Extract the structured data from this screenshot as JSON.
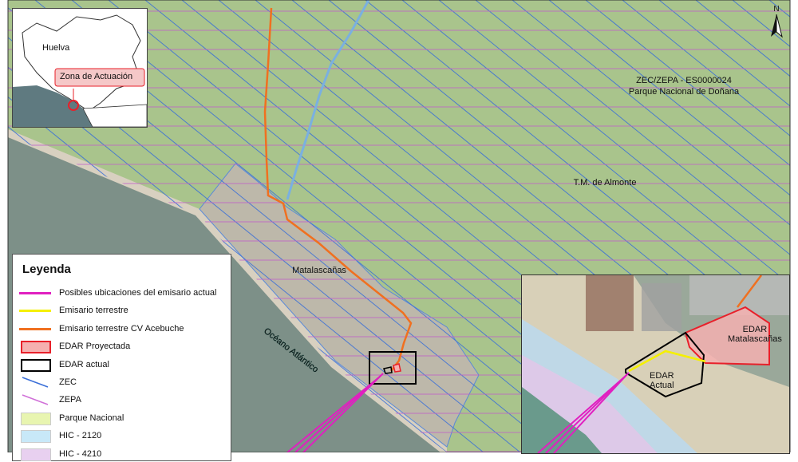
{
  "map_labels": {
    "zec_zepa_line1": "ZEC/ZEPA - ES0000024",
    "zec_zepa_line2": "Parque Nacional de Doñana",
    "tm_almonte": "T.M. de Almonte",
    "matalascanas": "Matalascañas",
    "oceano": "Océano Atlántico",
    "north": "N"
  },
  "locator": {
    "province": "Huelva",
    "callout": "Zona de Actuación"
  },
  "inset": {
    "edar_matalascanas_line1": "EDAR",
    "edar_matalascanas_line2": "Matalascañas",
    "edar_actual_line1": "EDAR",
    "edar_actual_line2": "Actual"
  },
  "legend": {
    "title": "Leyenda",
    "items": [
      {
        "label": "Posibles ubicaciones del emisario actual",
        "symbol": "line",
        "color": "#e020c0"
      },
      {
        "label": "Emisario terrestre",
        "symbol": "line",
        "color": "#f5f000"
      },
      {
        "label": "Emisario terrestre CV Acebuche",
        "symbol": "line",
        "color": "#f07020"
      },
      {
        "label": "EDAR Proyectada",
        "symbol": "box",
        "color": "#e8202a",
        "fill": "#f5b0b0"
      },
      {
        "label": "EDAR actual",
        "symbol": "box",
        "color": "#000000",
        "fill": "#ffffff"
      },
      {
        "label": "ZEC",
        "symbol": "hatch",
        "color": "#3a6fd8"
      },
      {
        "label": "ZEPA",
        "symbol": "hatch",
        "color": "#d070d8"
      },
      {
        "label": "Parque Nacional",
        "symbol": "fill",
        "color": "#e8f5b0"
      },
      {
        "label": "HIC - 2120",
        "symbol": "fill",
        "color": "#c8e8f8"
      },
      {
        "label": "HIC - 4210",
        "symbol": "fill",
        "color": "#e8d0f0"
      }
    ]
  },
  "colors": {
    "land": "#a8c08a",
    "sea": "#7d9088",
    "town": "#b8b4a8",
    "zec_hatch": "#3a6fd8",
    "zepa_hatch": "#c060c8",
    "emisario_cv": "#f07020",
    "emisario_actual": "#e020c0"
  }
}
